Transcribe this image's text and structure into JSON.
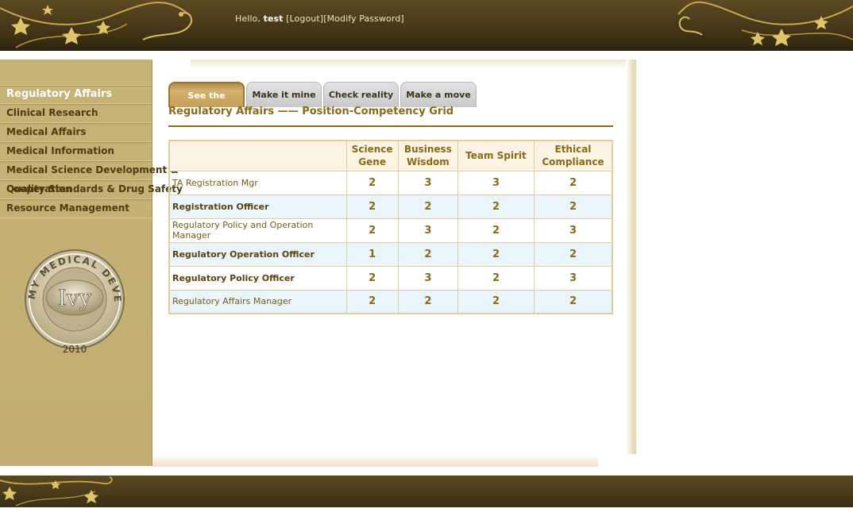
{
  "header": {
    "greeting_prefix": "Hello,",
    "username": "test",
    "logout": "[Logout]",
    "modify_password": "[Modify Password]"
  },
  "sidebar": {
    "items": [
      {
        "label": "Regulatory Affairs",
        "active": true
      },
      {
        "label": "Clinical Research"
      },
      {
        "label": "Medical Affairs"
      },
      {
        "label": "Medical Information"
      },
      {
        "label": "Medical Science Development &"
      },
      {
        "label": "Quality Standards & Drug Safety",
        "overlap": "Cooperation"
      },
      {
        "label": "Resource Management"
      }
    ]
  },
  "badge": {
    "ring_text": "MY MEDICAL DEVELOPMENT",
    "center": "Ivy",
    "year": "2010"
  },
  "tabs": [
    {
      "label": "See the journey",
      "active": true
    },
    {
      "label": "Make it mine"
    },
    {
      "label": "Check reality"
    },
    {
      "label": "Make a move"
    }
  ],
  "grid": {
    "title": "Regulatory Affairs —— Position-Competency Grid",
    "columns": [
      {
        "line1": "Science",
        "line2": "Gene"
      },
      {
        "line1": "Business",
        "line2": "Wisdom"
      },
      {
        "line1": "Team Spirit",
        "line2": ""
      },
      {
        "line1": "Ethical",
        "line2": "Compliance"
      }
    ],
    "rows": [
      {
        "name": "TA Registration Mgr",
        "bold": false,
        "values": [
          "2",
          "3",
          "3",
          "2"
        ]
      },
      {
        "name": "Registration Officer",
        "bold": true,
        "values": [
          "2",
          "2",
          "2",
          "2"
        ]
      },
      {
        "name": "Regulatory Policy and Operation Manager",
        "bold": false,
        "values": [
          "2",
          "3",
          "2",
          "3"
        ]
      },
      {
        "name": "Regulatory Operation Officer",
        "bold": true,
        "values": [
          "1",
          "2",
          "2",
          "2"
        ]
      },
      {
        "name": "Regulatory Policy Officer",
        "bold": true,
        "values": [
          "2",
          "3",
          "2",
          "3"
        ]
      },
      {
        "name": "Regulatory Affairs Manager",
        "bold": false,
        "values": [
          "2",
          "2",
          "2",
          "2"
        ]
      }
    ]
  },
  "colors": {
    "header_bg": "#3f3215",
    "sidebar_bg": "#c5b276",
    "accent_gold": "#8a6a18",
    "row_alt": "#eaf4fb"
  }
}
